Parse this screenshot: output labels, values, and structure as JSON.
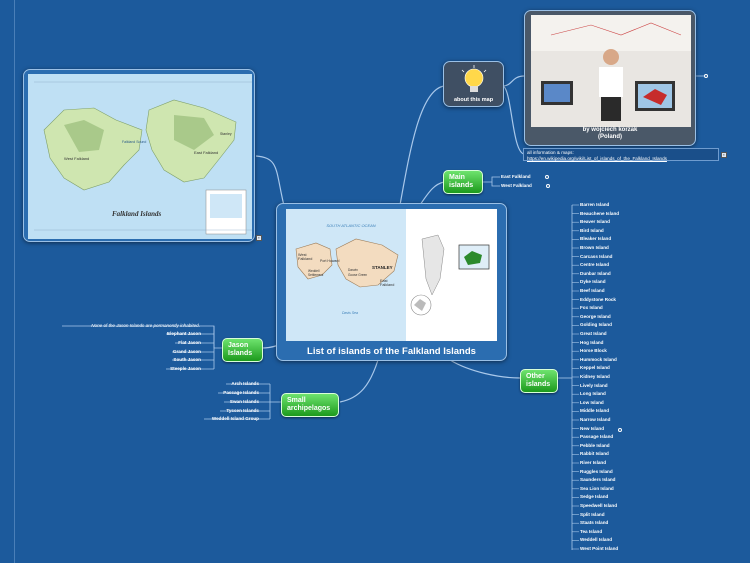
{
  "central": {
    "title": "List of islands of the Falkland Islands",
    "map_labels": {
      "ocean": "SOUTH ATLANTIC OCEAN",
      "west": "West Falkland",
      "east": "East Falkland",
      "port_howard": "Port Howard",
      "weddell": "Weddell Settlement",
      "stanley": "STANLEY",
      "goose": "Goose Green",
      "darwin": "Darwin",
      "davis": "Davis Sea"
    }
  },
  "about": {
    "label": "about this map",
    "photo_caption_line1": "by wojciech korzak",
    "photo_caption_line2": "(Poland)",
    "info_line1": "all information & maps:",
    "info_line2": "https://en.wikipedia.org/wiki/List_of_islands_of_the_Falkland_Islands"
  },
  "left_map": {
    "title": "Falkland Islands",
    "label_west": "West Falkland",
    "label_east": "East Falkland",
    "label_sound": "Falkland Sound",
    "label_stanley": "Stanley"
  },
  "main_islands": {
    "label_line1": "Main",
    "label_line2": "islands",
    "items": [
      "East Falkland",
      "West Falkland"
    ]
  },
  "jason_islands": {
    "label_line1": "Jason",
    "label_line2": "Islands",
    "note": "None of the Jason Islands are permanently inhabited.",
    "items": [
      "Elephant Jason",
      "Flat Jason",
      "Grand Jason",
      "South Jason",
      "Steeple Jason"
    ]
  },
  "small_archipelagos": {
    "label_line1": "Small",
    "label_line2": "archipelagos",
    "items": [
      "Arch Islands",
      "Passage Islands",
      "Swan Islands",
      "Tyssen Islands",
      "Weddell Island Group"
    ]
  },
  "other_islands": {
    "label_line1": "Other",
    "label_line2": "islands",
    "items": [
      "Barren Island",
      "Beauchene Island",
      "Beaver Island",
      "Bird Island",
      "Bleaker Island",
      "Brown Island",
      "Carcass Island",
      "Centre Island",
      "Dunbar Island",
      "Dyke Island",
      "Beef Island",
      "Eddystone Rock",
      "Fox Island",
      "George Island",
      "Golding Island",
      "Great Island",
      "Hog Island",
      "Horse Block",
      "Hummock Island",
      "Keppel Island",
      "Kidney Island",
      "Lively Island",
      "Long Island",
      "Low Island",
      "Middle Island",
      "Narrow Island",
      "New Island",
      "Passage Island",
      "Pebble Island",
      "Rabbit Island",
      "River Island",
      "Ruggles Island",
      "Saunders Island",
      "Sea Lion Island",
      "Sedge Island",
      "Speedwell Island",
      "Split Island",
      "Staats Island",
      "Tea Island",
      "Weddell Island",
      "West Point Island"
    ]
  },
  "colors": {
    "background": "#1c5a9c",
    "node_green": "#2ab52a",
    "land": "#f3dcc0",
    "sea": "#cfe7f7"
  }
}
